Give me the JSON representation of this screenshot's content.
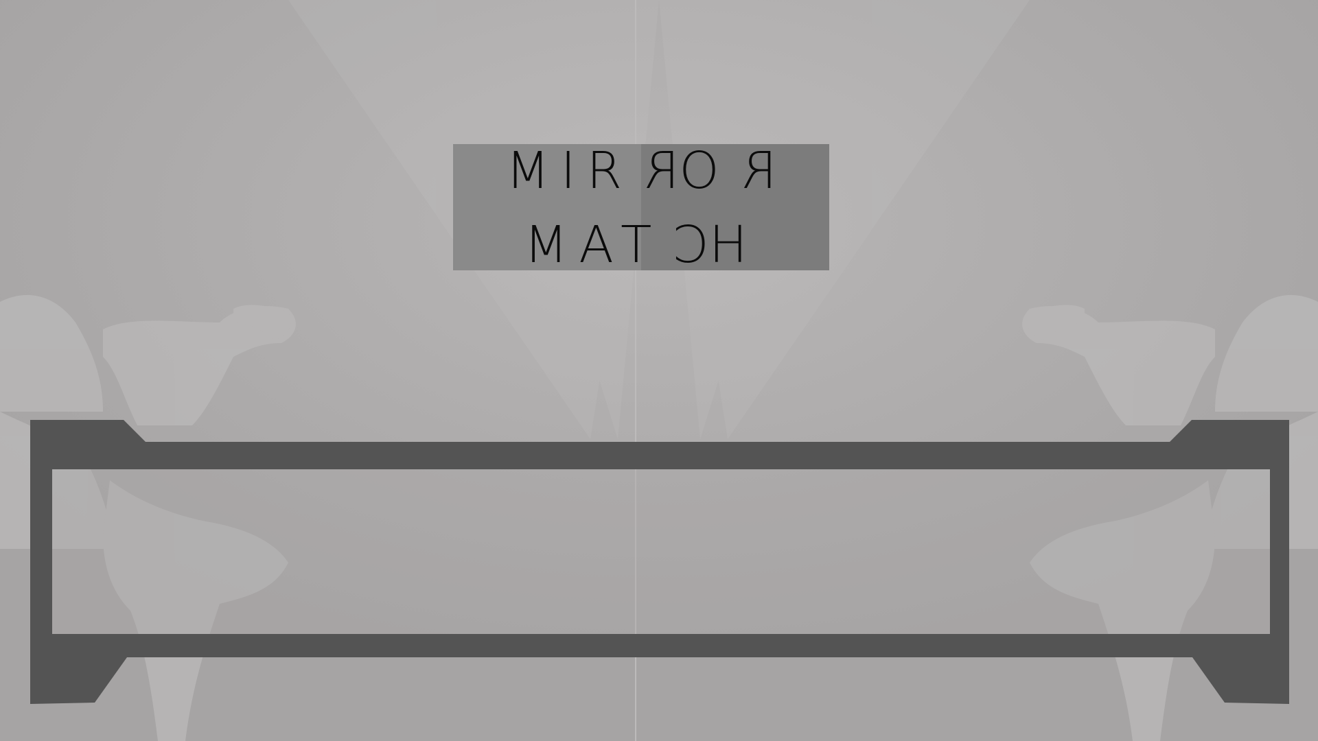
{
  "title": {
    "line1": "MIRROR",
    "line2": "MATCH",
    "line1_mirrored_indices": [
      3,
      5
    ],
    "line2_mirrored_indices": [
      3
    ]
  },
  "colors": {
    "background": "#aaa8a8",
    "title_box_left": "#8a8a8a",
    "title_box_right": "#7c7c7c",
    "frame": "#545454",
    "frame_inner": "#a9a7a7",
    "silhouette": "#bcbaba",
    "text": "#0b0b0b"
  }
}
